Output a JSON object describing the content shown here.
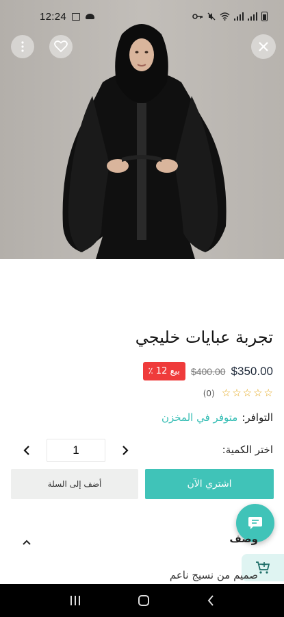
{
  "status_bar": {
    "time": "12:24"
  },
  "hero": {
    "description": "product-photo"
  },
  "product": {
    "title": "تجربة عبايات خليجي",
    "price_current": "$350.00",
    "price_old": "$400.00",
    "sale_badge": "بيع 12 ٪",
    "rating_count": "(0)",
    "rating_stars": 0
  },
  "availability": {
    "label": "التوافر:",
    "value": "متوفر في المخزن"
  },
  "quantity": {
    "label": "اختر الكمية:",
    "value": "1"
  },
  "actions": {
    "buy_now": "اشتري الآن",
    "add_to_cart": "أضف إلى السلة"
  },
  "description": {
    "heading": "وصف",
    "text": "صميم من نسيج ناعم"
  },
  "colors": {
    "accent": "#40c3b8",
    "sale": "#ef3b3b",
    "available": "#34bdb4",
    "star": "#e3a515"
  }
}
